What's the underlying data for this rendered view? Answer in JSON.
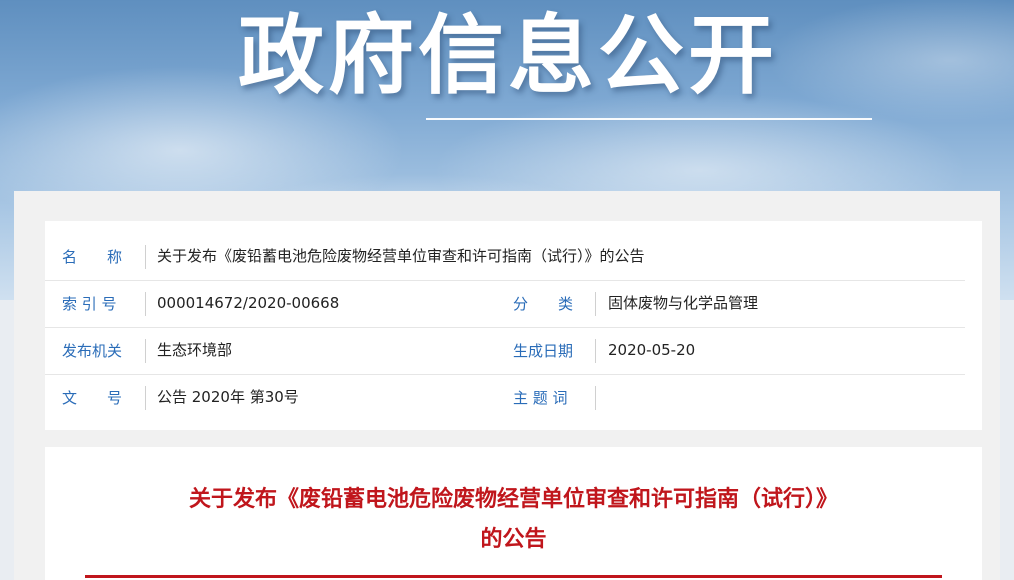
{
  "banner": {
    "title": "政府信息公开"
  },
  "info": {
    "name_label": "名　　称",
    "name_value": "关于发布《废铅蓄电池危险废物经营单位审查和许可指南（试行）》的公告",
    "index_label": "索 引 号",
    "index_value": "000014672/2020-00668",
    "category_label": "分　　类",
    "category_value": "固体废物与化学品管理",
    "issuer_label": "发布机关",
    "issuer_value": "生态环境部",
    "date_label": "生成日期",
    "date_value": "2020-05-20",
    "docno_label": "文　　号",
    "docno_value": "公告 2020年 第30号",
    "keywords_label": "主 题 词",
    "keywords_value": ""
  },
  "article": {
    "title_line1": "关于发布《废铅蓄电池危险废物经营单位审查和许可指南（试行）》",
    "title_line2": "的公告"
  },
  "colors": {
    "label_blue": "#2a6cb8",
    "title_red": "#c0161c"
  }
}
